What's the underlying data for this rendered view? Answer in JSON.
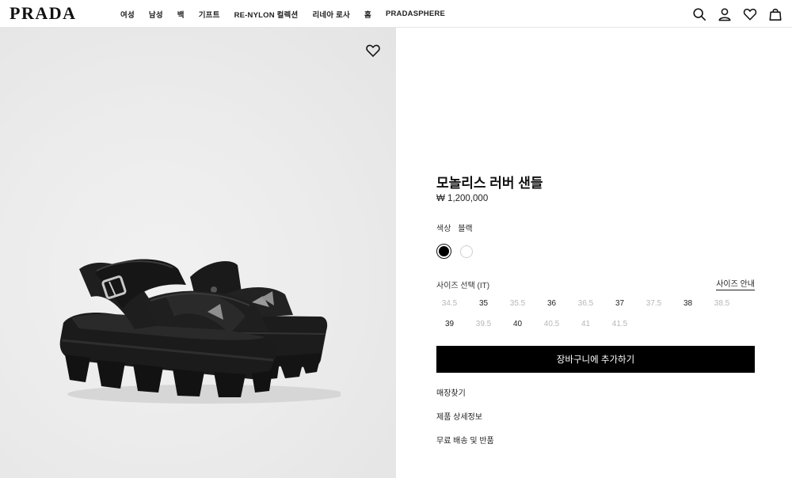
{
  "header": {
    "logo": "PRADA",
    "nav": [
      "여성",
      "남성",
      "백",
      "기프트",
      "RE-NYLON 컬렉션",
      "리네아 로사",
      "홈",
      "PRADASPHERE"
    ],
    "icons": [
      "search-icon",
      "account-icon",
      "wishlist-icon",
      "shopping-bag-icon"
    ]
  },
  "product": {
    "image_alt": "모놀리스 러버 샌들",
    "title": "모놀리스 러버 샌들",
    "price": "₩ 1,200,000",
    "color_label": "색상",
    "color_value": "블랙",
    "colors": [
      {
        "name": "블랙",
        "hex": "#000000",
        "selected": true
      },
      {
        "name": "화이트",
        "hex": "#ffffff",
        "selected": false
      }
    ],
    "size_label": "사이즈 선택 (IT)",
    "size_guide": "사이즈 안내",
    "sizes": [
      {
        "label": "34.5",
        "available": false
      },
      {
        "label": "35",
        "available": true
      },
      {
        "label": "35.5",
        "available": false
      },
      {
        "label": "36",
        "available": true
      },
      {
        "label": "36.5",
        "available": false
      },
      {
        "label": "37",
        "available": true
      },
      {
        "label": "37.5",
        "available": false
      },
      {
        "label": "38",
        "available": true
      },
      {
        "label": "38.5",
        "available": false
      },
      {
        "label": "39",
        "available": true
      },
      {
        "label": "39.5",
        "available": false
      },
      {
        "label": "40",
        "available": true
      },
      {
        "label": "40.5",
        "available": false
      },
      {
        "label": "41",
        "available": false
      },
      {
        "label": "41.5",
        "available": false
      }
    ],
    "add_to_cart": "장바구니에 추가하기",
    "links": [
      "매장찾기",
      "제품 상세정보",
      "무료 배송 및 반품"
    ]
  },
  "colors": {
    "text": "#111111",
    "unavailable": "#b7b7b7",
    "button_bg": "#000000",
    "image_bg": "#ececec"
  }
}
